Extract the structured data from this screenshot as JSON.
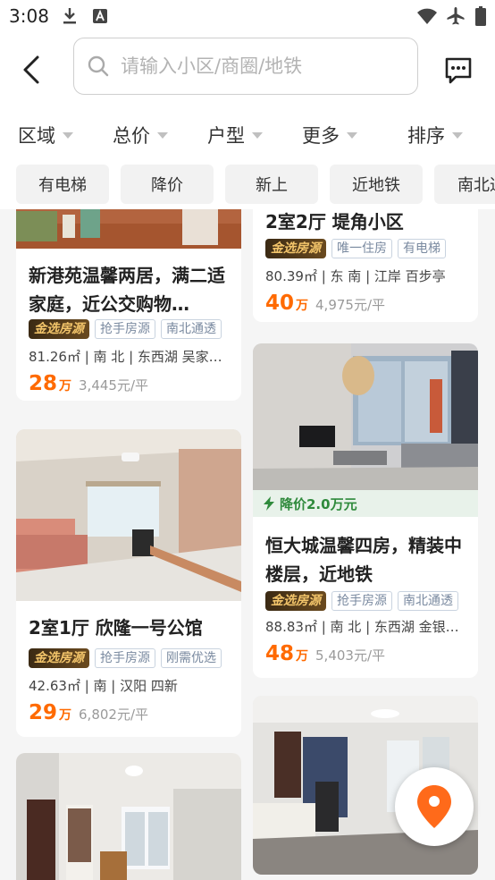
{
  "status_bar": {
    "time": "3:08"
  },
  "search": {
    "placeholder": "请输入小区/商圈/地铁"
  },
  "filters": [
    {
      "label": "区域"
    },
    {
      "label": "总价"
    },
    {
      "label": "户型"
    },
    {
      "label": "更多"
    },
    {
      "label": "排序"
    }
  ],
  "quick_tags": [
    {
      "label": "有电梯"
    },
    {
      "label": "降价"
    },
    {
      "label": "新上"
    },
    {
      "label": "近地铁"
    },
    {
      "label": "南北通透"
    }
  ],
  "listings": [
    {
      "title": "新港苑温馨两居，满二适家庭，近公交购物…",
      "gold_badge": "金选房源",
      "tags": [
        "抢手房源",
        "南北通透"
      ],
      "info": "81.26㎡ | 南 北 | 东西湖 吴家…",
      "price": "28",
      "price_unit": "万",
      "unit_price": "3,445元/平"
    },
    {
      "title": "2室1厅 欣隆一号公馆",
      "gold_badge": "金选房源",
      "tags": [
        "抢手房源",
        "刚需优选"
      ],
      "info": "42.63㎡ | 南 | 汉阳 四新",
      "price": "29",
      "price_unit": "万",
      "unit_price": "6,802元/平"
    },
    {
      "title": "2室2厅 堤角小区",
      "gold_badge": "金选房源",
      "tags": [
        "唯一住房",
        "有电梯"
      ],
      "info": "80.39㎡ | 东 南 | 江岸 百步亭",
      "price": "40",
      "price_unit": "万",
      "unit_price": "4,975元/平"
    },
    {
      "title": "恒大城温馨四房，精装中楼层，近地铁",
      "price_cut": "降价2.0万元",
      "gold_badge": "金选房源",
      "tags": [
        "抢手房源",
        "南北通透"
      ],
      "info": "88.83㎡ | 南 北 | 东西湖 金银…",
      "price": "48",
      "price_unit": "万",
      "unit_price": "5,403元/平"
    }
  ]
}
